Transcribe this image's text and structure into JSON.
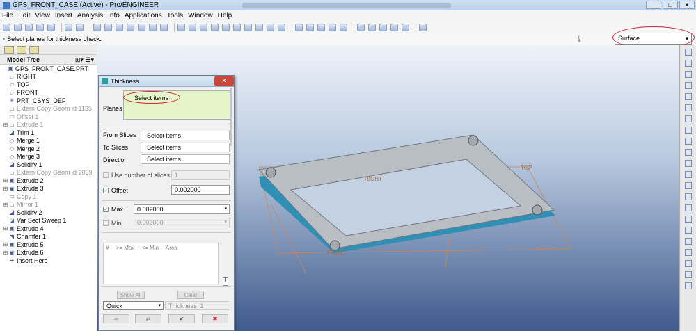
{
  "window": {
    "title": "GPS_FRONT_CASE (Active) - Pro/ENGINEER",
    "buttons": [
      "_",
      "□",
      "✕"
    ]
  },
  "menu": [
    "File",
    "Edit",
    "View",
    "Insert",
    "Analysis",
    "Info",
    "Applications",
    "Tools",
    "Window",
    "Help"
  ],
  "status_message": "Select planes for thickness check.",
  "filter": {
    "value": "Surface"
  },
  "model_tree": {
    "header": "Model Tree",
    "tools": "⊞▾ ☰▾",
    "items": [
      {
        "label": "GPS_FRONT_CASE.PRT",
        "icon": "▣",
        "exp": "",
        "grey": false
      },
      {
        "label": "RIGHT",
        "icon": "▱",
        "exp": "",
        "grey": false
      },
      {
        "label": "TOP",
        "icon": "▱",
        "exp": "",
        "grey": false
      },
      {
        "label": "FRONT",
        "icon": "▱",
        "exp": "",
        "grey": false
      },
      {
        "label": "PRT_CSYS_DEF",
        "icon": "✳",
        "exp": "",
        "grey": false
      },
      {
        "label": "Extern Copy Geom id 1135",
        "icon": "▭",
        "exp": "",
        "grey": true
      },
      {
        "label": "Offset 1",
        "icon": "▭",
        "exp": "",
        "grey": true
      },
      {
        "label": "Extrude 1",
        "icon": "▭",
        "exp": "⊞",
        "grey": true
      },
      {
        "label": "Trim 1",
        "icon": "◪",
        "exp": "",
        "grey": false
      },
      {
        "label": "Merge 1",
        "icon": "◇",
        "exp": "",
        "grey": false
      },
      {
        "label": "Merge 2",
        "icon": "◇",
        "exp": "",
        "grey": false
      },
      {
        "label": "Merge 3",
        "icon": "◇",
        "exp": "",
        "grey": false
      },
      {
        "label": "Solidify 1",
        "icon": "◪",
        "exp": "",
        "grey": false
      },
      {
        "label": "Extern Copy Geom id 2039",
        "icon": "▭",
        "exp": "",
        "grey": true
      },
      {
        "label": "Extrude 2",
        "icon": "▣",
        "exp": "⊞",
        "grey": false
      },
      {
        "label": "Extrude 3",
        "icon": "▣",
        "exp": "⊞",
        "grey": false
      },
      {
        "label": "Copy 1",
        "icon": "▭",
        "exp": "",
        "grey": true
      },
      {
        "label": "Mirror 1",
        "icon": "▭",
        "exp": "⊞",
        "grey": true
      },
      {
        "label": "Solidify 2",
        "icon": "◪",
        "exp": "",
        "grey": false
      },
      {
        "label": "Var Sect Sweep 1",
        "icon": "◪",
        "exp": "",
        "grey": false
      },
      {
        "label": "Extrude 4",
        "icon": "▣",
        "exp": "⊞",
        "grey": false
      },
      {
        "label": "Chamfer 1",
        "icon": "◥",
        "exp": "",
        "grey": false
      },
      {
        "label": "Extrude 5",
        "icon": "▣",
        "exp": "⊞",
        "grey": false
      },
      {
        "label": "Extrude 6",
        "icon": "▣",
        "exp": "⊞",
        "grey": false
      },
      {
        "label": "Insert Here",
        "icon": "➜",
        "exp": "",
        "grey": false
      }
    ]
  },
  "dialog": {
    "title": "Thickness",
    "planes_label": "Planes",
    "planes_value": "Select items",
    "from_slices_label": "From Slices",
    "from_slices_value": "Select items",
    "to_slices_label": "To Slices",
    "to_slices_value": "Select items",
    "direction_label": "Direction",
    "direction_value": "Select items",
    "use_slices_label": "Use number of slices",
    "use_slices_value": "1",
    "offset_label": "Offset",
    "offset_value": "0.002000",
    "max_label": "Max",
    "max_value": "0.002000",
    "min_label": "Min",
    "min_value": "0.002000",
    "table_cols": [
      "#",
      ">= Max",
      "<= Min",
      "Area"
    ],
    "show_all": "Show All",
    "clear": "Clear",
    "mode": "Quick",
    "name": "Thickness_1"
  },
  "viewport": {
    "labels": {
      "top": "TOP",
      "right": "RIGHT",
      "front": "FRONT"
    }
  },
  "colors": {
    "dialog_header": "#c5d8ee",
    "planes_bg": "#e6f5c9",
    "highlight_ellipse": "#c8263a",
    "part_body": "#b9bec4",
    "part_side": "#2f8fb5"
  }
}
